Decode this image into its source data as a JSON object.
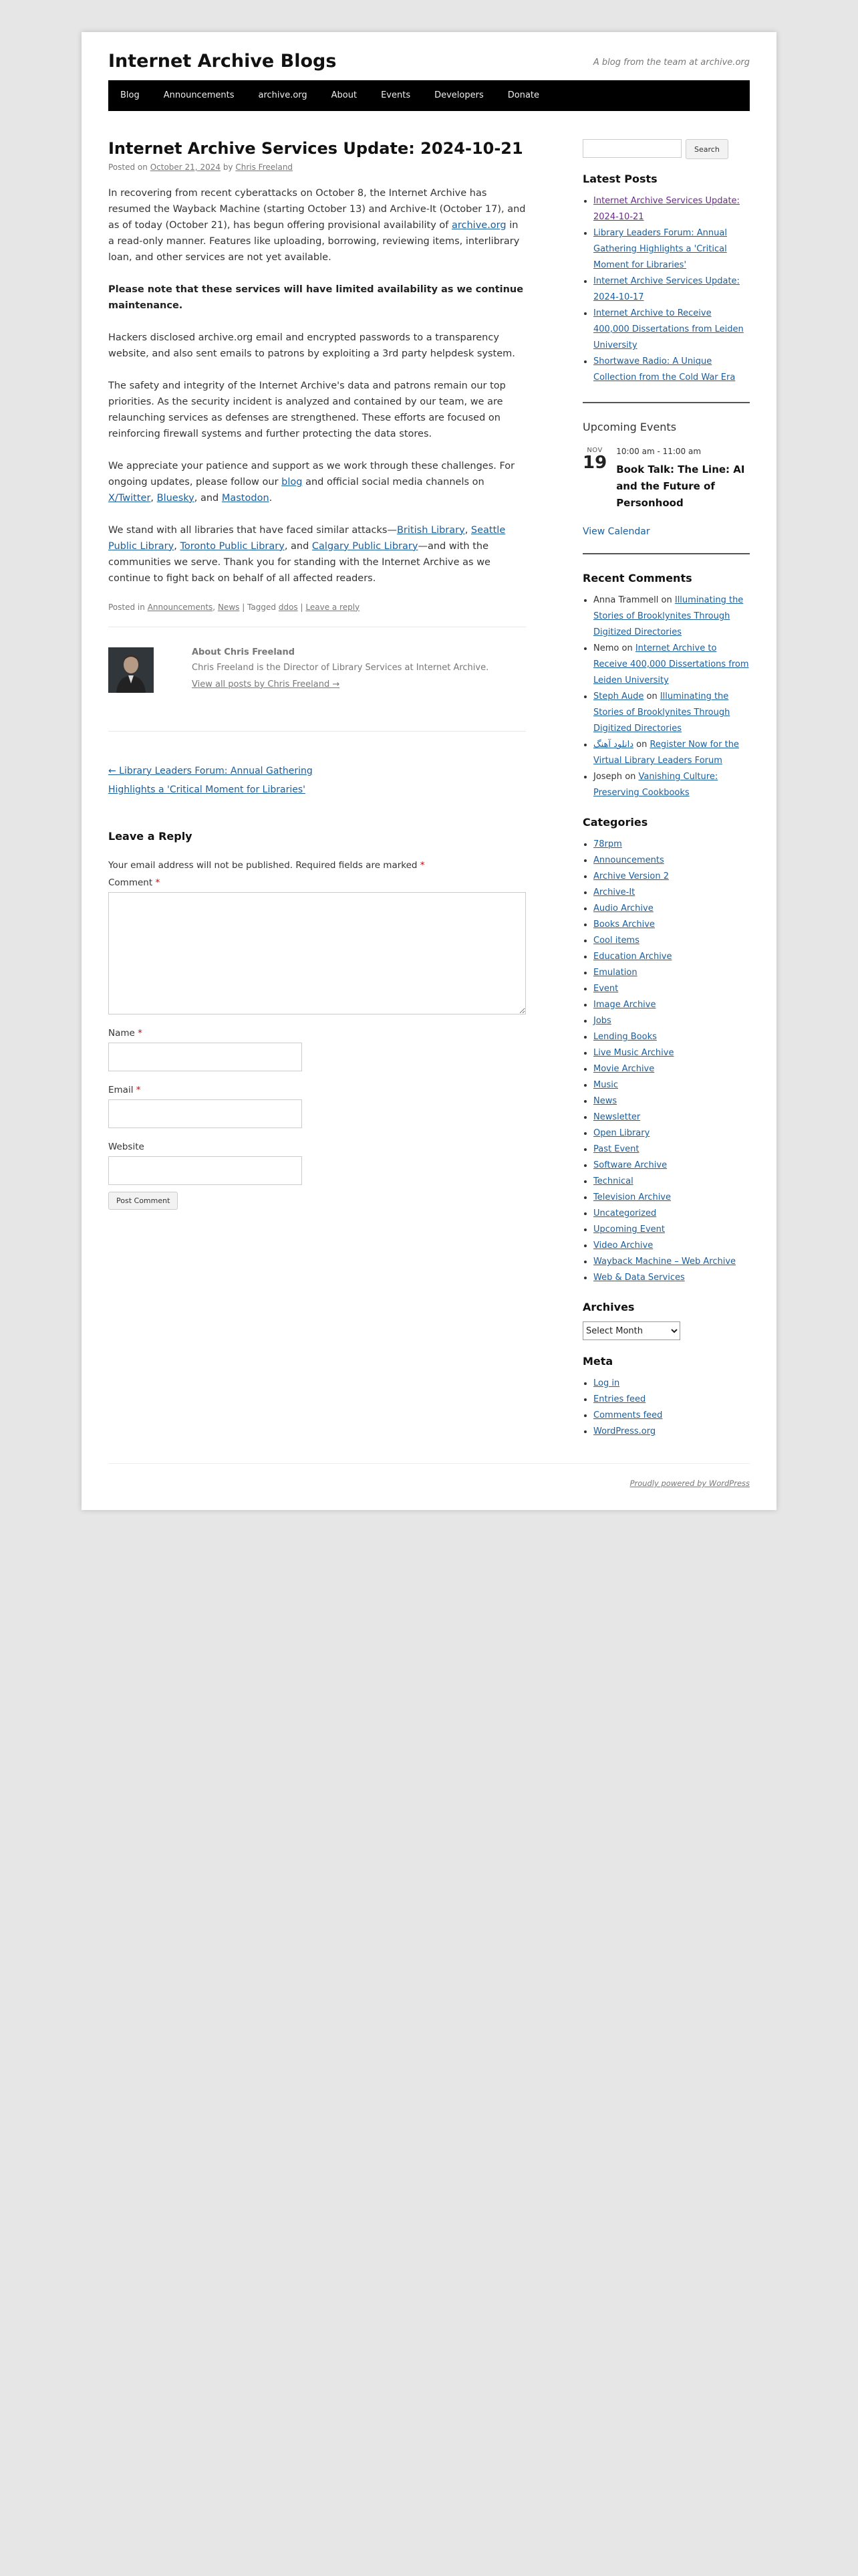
{
  "site": {
    "title": "Internet Archive Blogs",
    "description": "A blog from the team at archive.org"
  },
  "nav": [
    "Blog",
    "Announcements",
    "archive.org",
    "About",
    "Events",
    "Developers",
    "Donate"
  ],
  "post": {
    "title": "Internet Archive Services Update: 2024-10-21",
    "posted_on": "Posted on",
    "date": "October 21, 2024",
    "by": "by",
    "author": "Chris Freeland",
    "p1_a": "In recovering from recent cyberattacks on October 8, the Internet Archive has resumed the Wayback Machine (starting October 13) and Archive-It (October 17), and as of today (October 21), has begun offering provisional availability of ",
    "p1_link": "archive.org",
    "p1_b": " in a read-only manner. Features like uploading, borrowing, reviewing items, interlibrary loan, and other services are not yet available.",
    "p2": "Please note that these services will have limited availability as we continue maintenance.",
    "p3": "Hackers disclosed archive.org email and encrypted passwords to a transparency website, and also sent emails to patrons by exploiting a 3rd party helpdesk system.",
    "p4": "The safety and integrity of the Internet Archive's data and patrons remain our top priorities. As the security incident is analyzed and contained by our team, we are relaunching services as defenses are strengthened. These efforts are focused on reinforcing firewall systems and further protecting the data stores.",
    "p5_a": "We appreciate your patience and support as we work through these challenges. For ongoing updates, please follow our ",
    "p5_blog": "blog",
    "p5_b": " and official social media channels on ",
    "p5_x": "X/Twitter",
    "p5_c": ", ",
    "p5_bluesky": "Bluesky",
    "p5_d": ", and ",
    "p5_mastodon": "Mastodon",
    "p5_e": ".",
    "p6_a": "We stand with all libraries that have faced similar attacks—",
    "p6_british": "British Library",
    "p6_b": ", ",
    "p6_seattle": "Seattle Public Library",
    "p6_c": ", ",
    "p6_toronto": "Toronto Public Library",
    "p6_d": ", and ",
    "p6_calgary": "Calgary Public Library",
    "p6_e": "—and with the communities we serve. Thank you for standing with the Internet Archive as we continue to fight back on behalf of all affected readers.",
    "utility": {
      "posted_in": "Posted in",
      "cat1": "Announcements",
      "comma": ",",
      "cat2": "News",
      "tagged": "| Tagged",
      "tag": "ddos",
      "pipe": "|",
      "leave_reply": "Leave a reply"
    }
  },
  "author_box": {
    "about": "About Chris Freeland",
    "bio": "Chris Freeland is the Director of Library Services at Internet Archive.",
    "view_all": "View all posts by Chris Freeland →"
  },
  "post_nav": {
    "prev": "← Library Leaders Forum: Annual Gathering",
    "next": "Highlights a 'Critical Moment for Libraries'"
  },
  "reply_form": {
    "title": "Leave a Reply",
    "notes": "Your email address will not be published. Required fields are marked",
    "required_mark": "*",
    "comment_label": "Comment",
    "name_label": "Name",
    "email_label": "Email",
    "website_label": "Website",
    "submit": "Post Comment"
  },
  "sidebar": {
    "search_button": "Search",
    "latest_posts_title": "Latest Posts",
    "latest_posts": [
      "Internet Archive Services Update: 2024-10-21",
      "Library Leaders Forum: Annual Gathering Highlights a 'Critical Moment for Libraries'",
      "Internet Archive Services Update: 2024-10-17",
      "Internet Archive to Receive 400,000 Dissertations from Leiden University",
      "Shortwave Radio: A Unique Collection from the Cold War Era"
    ],
    "upcoming_title": "Upcoming Events",
    "event": {
      "month": "NOV",
      "day": "19",
      "time": "10:00 am - 11:00 am",
      "title": "Book Talk: The Line: AI and the Future of Personhood"
    },
    "view_calendar": "View Calendar",
    "recent_comments_title": "Recent Comments",
    "recent_comments": [
      {
        "author": "Anna Trammell",
        "on": "on",
        "post": "Illuminating the Stories of Brooklynites Through Digitized Directories"
      },
      {
        "author": "Nemo",
        "on": "on",
        "post": "Internet Archive to Receive 400,000 Dissertations from Leiden University"
      },
      {
        "author": "Steph Aude",
        "on": "on",
        "post": "Illuminating the Stories of Brooklynites Through Digitized Directories"
      },
      {
        "author": "دانلود آهنگ",
        "on": "on",
        "post": "Register Now for the Virtual Library Leaders Forum"
      },
      {
        "author": "Joseph",
        "on": "on",
        "post": "Vanishing Culture: Preserving Cookbooks"
      }
    ],
    "categories_title": "Categories",
    "categories": [
      "78rpm",
      "Announcements",
      "Archive Version 2",
      "Archive-It",
      "Audio Archive",
      "Books Archive",
      "Cool items",
      "Education Archive",
      "Emulation",
      "Event",
      "Image Archive",
      "Jobs",
      "Lending Books",
      "Live Music Archive",
      "Movie Archive",
      "Music",
      "News",
      "Newsletter",
      "Open Library",
      "Past Event",
      "Software Archive",
      "Technical",
      "Television Archive",
      "Uncategorized",
      "Upcoming Event",
      "Video Archive",
      "Wayback Machine – Web Archive",
      "Web & Data Services"
    ],
    "archives_title": "Archives",
    "archives_select": "Select Month",
    "meta_title": "Meta",
    "meta": [
      "Log in",
      "Entries feed",
      "Comments feed",
      "WordPress.org"
    ]
  },
  "footer": {
    "powered": "Proudly powered by WordPress"
  }
}
